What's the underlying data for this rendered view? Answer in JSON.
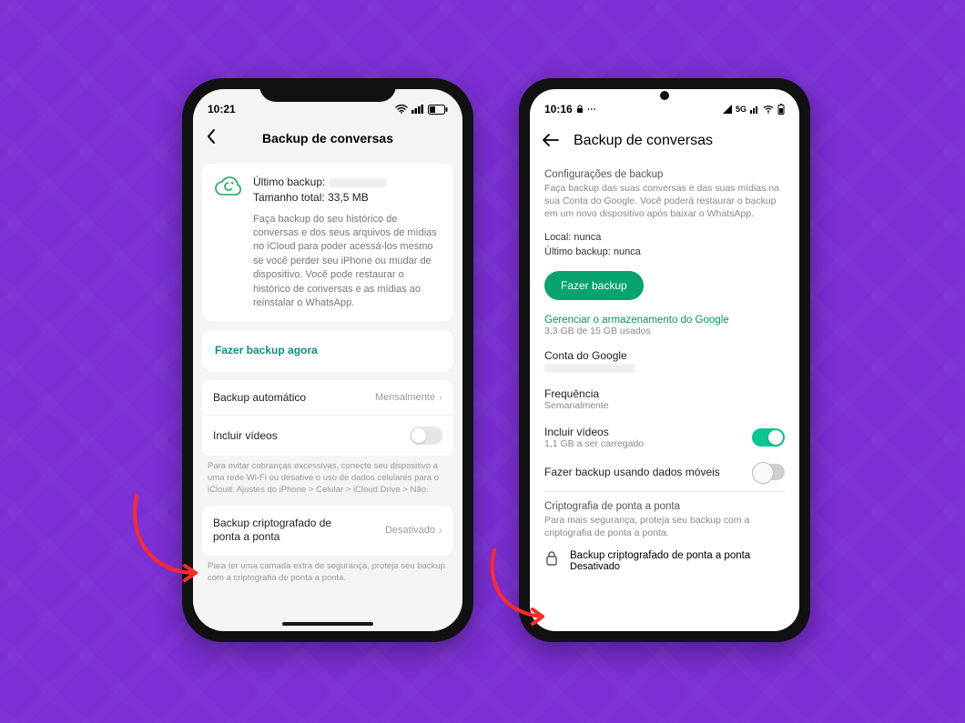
{
  "ios": {
    "status": {
      "time": "10:21"
    },
    "navbar": {
      "title": "Backup de conversas"
    },
    "card1": {
      "last_backup_label": "Último backup:",
      "total_size_label": "Tamanho total:",
      "total_size_value": "33,5 MB",
      "desc": "Faça backup do seu histórico de conversas e dos seus arquivos de mídias no iCloud para poder acessá-los mesmo se você perder seu iPhone ou mudar de dispositivo. Você pode restaurar o histórico de conversas e as mídias ao reinstalar o WhatsApp."
    },
    "backup_now": "Fazer backup agora",
    "auto_backup": {
      "label": "Backup automático",
      "value": "Mensalmente"
    },
    "include_videos": "Incluir vídeos",
    "note1": "Para evitar cobranças excessivas, conecte seu dispositivo a uma rede Wi-Fi ou desative o uso de dados celulares para o iCloud: Ajustes do iPhone > Celular > iCloud Drive > Não.",
    "e2e": {
      "label": "Backup criptografado de ponta a ponta",
      "value": "Desativado"
    },
    "note2": "Para ter uma camada extra de segurança, proteja seu backup com a criptografia de ponta a ponta."
  },
  "android": {
    "status": {
      "time": "10:16"
    },
    "status_right": "5G",
    "navbar": {
      "title": "Backup de conversas"
    },
    "section_title": "Configurações de backup",
    "section_desc": "Faça backup das suas conversas e das suas mídias na sua Conta do Google. Você poderá restaurar o backup em um novo dispositivo após baixar o WhatsApp.",
    "local": {
      "label": "Local:",
      "value": "nunca"
    },
    "last_backup": {
      "label": "Último backup:",
      "value": "nunca"
    },
    "do_backup": "Fazer backup",
    "manage_storage": "Gerenciar o armazenamento do Google",
    "storage_used": "3,3 GB de 15 GB usados",
    "google_account_label": "Conta do Google",
    "frequency": {
      "label": "Frequência",
      "value": "Semanalmente"
    },
    "include_videos": {
      "label": "Incluir vídeos",
      "sub": "1,1 GB a ser carregado"
    },
    "mobile_data": "Fazer backup usando dados móveis",
    "e2e_section_title": "Criptografia de ponta a ponta",
    "e2e_section_desc": "Para mais segurança, proteja seu backup com a criptografia de ponta a ponta.",
    "e2e_row": {
      "label": "Backup criptografado de ponta a ponta",
      "value": "Desativado"
    }
  }
}
